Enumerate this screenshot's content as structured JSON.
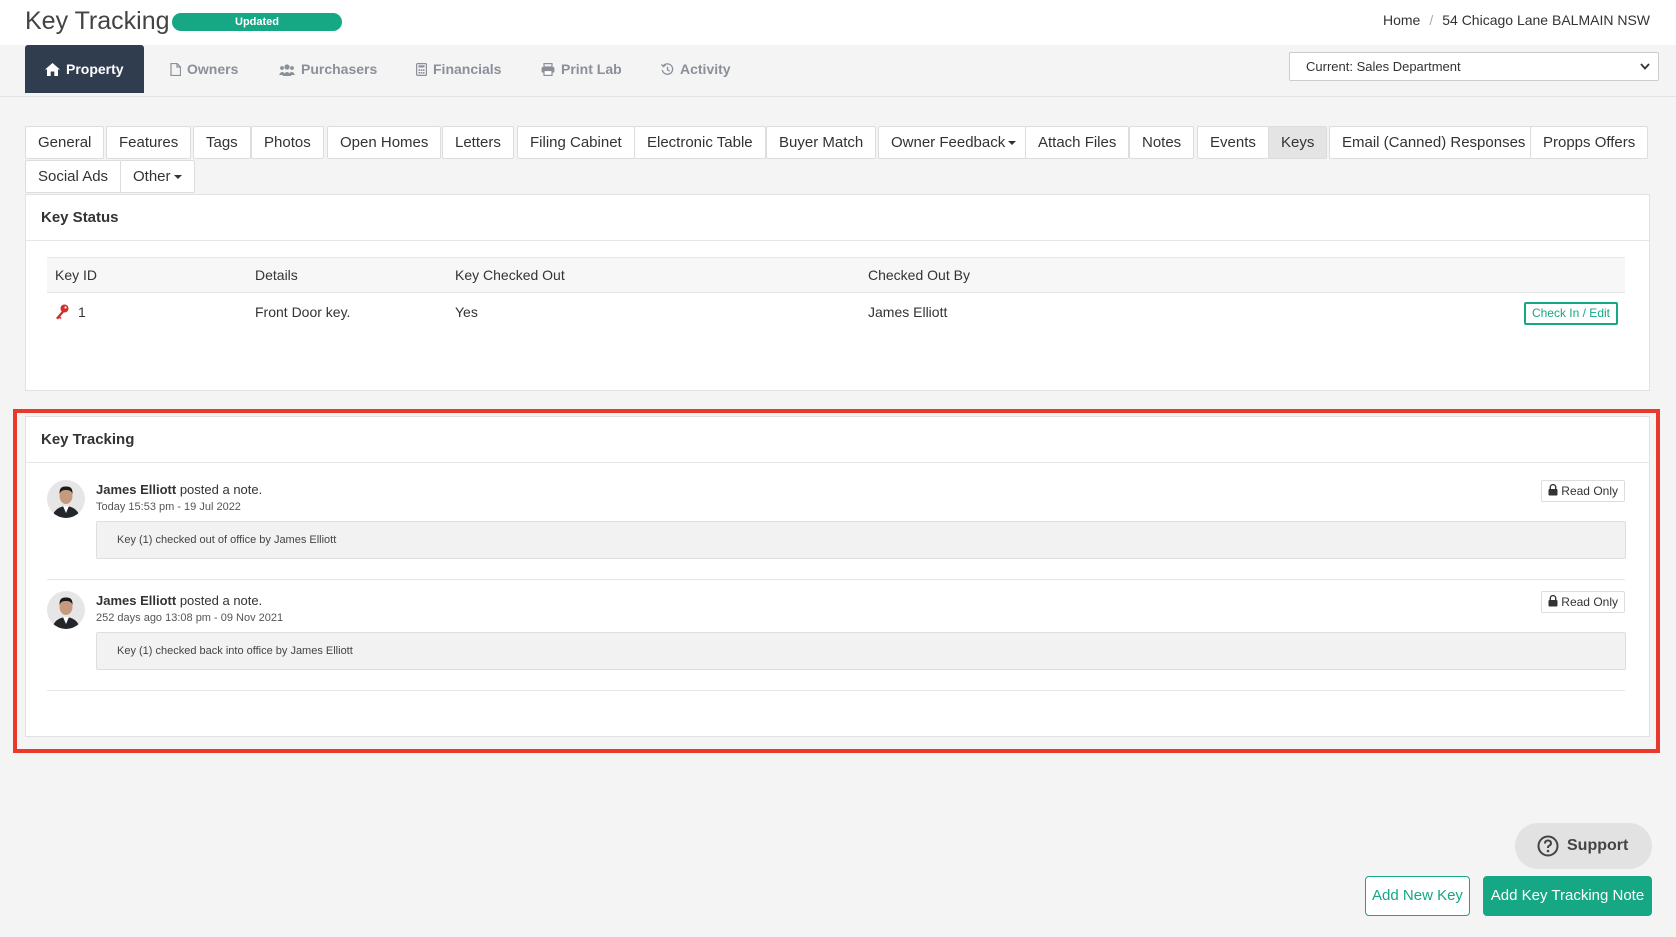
{
  "header": {
    "title": "Key Tracking",
    "status": "Updated",
    "breadcrumb": {
      "home": "Home",
      "sep": "/",
      "current": "54 Chicago Lane BALMAIN NSW"
    }
  },
  "nav": {
    "tabs": [
      "Property",
      "Owners",
      "Purchasers",
      "Financials",
      "Print Lab",
      "Activity"
    ],
    "department": "Current: Sales Department"
  },
  "subtabs": [
    "General",
    "Features",
    "Tags",
    "Photos",
    "Open Homes",
    "Letters",
    "Filing Cabinet",
    "Electronic Table",
    "Buyer Match",
    "Owner Feedback",
    "Attach Files",
    "Notes",
    "Events",
    "Keys",
    "Email (Canned) Responses",
    "Propps Offers",
    "Social Ads",
    "Other"
  ],
  "key_status": {
    "title": "Key Status",
    "columns": [
      "Key ID",
      "Details",
      "Key Checked Out",
      "Checked Out By"
    ],
    "row": {
      "id": "1",
      "details": "Front Door key.",
      "checked_out": "Yes",
      "by": "James Elliott",
      "action": "Check In / Edit"
    }
  },
  "key_tracking": {
    "title": "Key Tracking",
    "notes": [
      {
        "author": "James Elliott",
        "verb": "posted a note.",
        "time": "Today 15:53 pm - 19 Jul 2022",
        "badge": "Read Only",
        "body": "Key (1) checked out of office by James Elliott"
      },
      {
        "author": "James Elliott",
        "verb": "posted a note.",
        "time": "252 days ago 13:08 pm - 09 Nov 2021",
        "badge": "Read Only",
        "body": "Key (1) checked back into office by James Elliott"
      }
    ]
  },
  "footer": {
    "support": "Support",
    "add_key": "Add New Key",
    "add_note": "Add Key Tracking Note"
  },
  "colors": {
    "accent": "#16a785",
    "nav_active": "#2f3d4f",
    "highlight": "#e8392c",
    "key_icon": "#d0302b"
  }
}
